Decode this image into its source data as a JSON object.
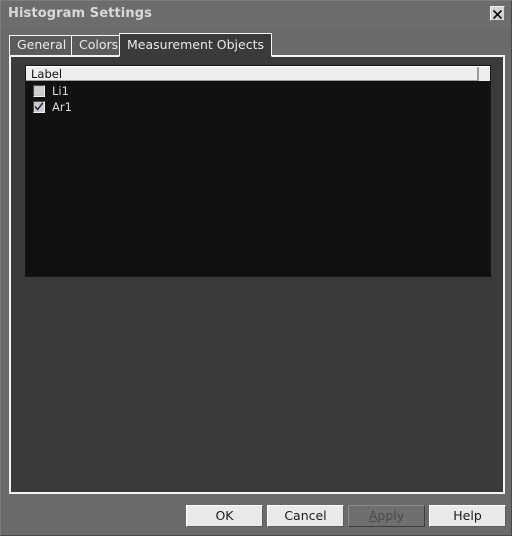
{
  "window": {
    "title": "Histogram Settings",
    "close_icon": "close-icon"
  },
  "tabs": [
    {
      "label": "General",
      "active": false
    },
    {
      "label": "Colors",
      "active": false
    },
    {
      "label": "Measurement Objects",
      "active": true
    }
  ],
  "list": {
    "columns": [
      "Label"
    ],
    "rows": [
      {
        "label": "Li1",
        "checked": false
      },
      {
        "label": "Ar1",
        "checked": true
      }
    ]
  },
  "buttons": {
    "ok": "OK",
    "cancel": "Cancel",
    "apply_mnemonic": "A",
    "apply_rest": "pply",
    "help": "Help"
  },
  "colors": {
    "window_bg": "#6a6a6a",
    "titlebar_bg": "#6d6d6d",
    "title_text": "#d9d9d9",
    "panel_bg": "#3a3a3a",
    "panel_border": "#f4f4f4",
    "list_bg": "#111111",
    "list_header_bg": "#eeeeee",
    "tab_inactive_bg": "#5b5b5b",
    "button_bg": "#e9e9e9",
    "button_disabled_bg": "#6f6f6f"
  }
}
